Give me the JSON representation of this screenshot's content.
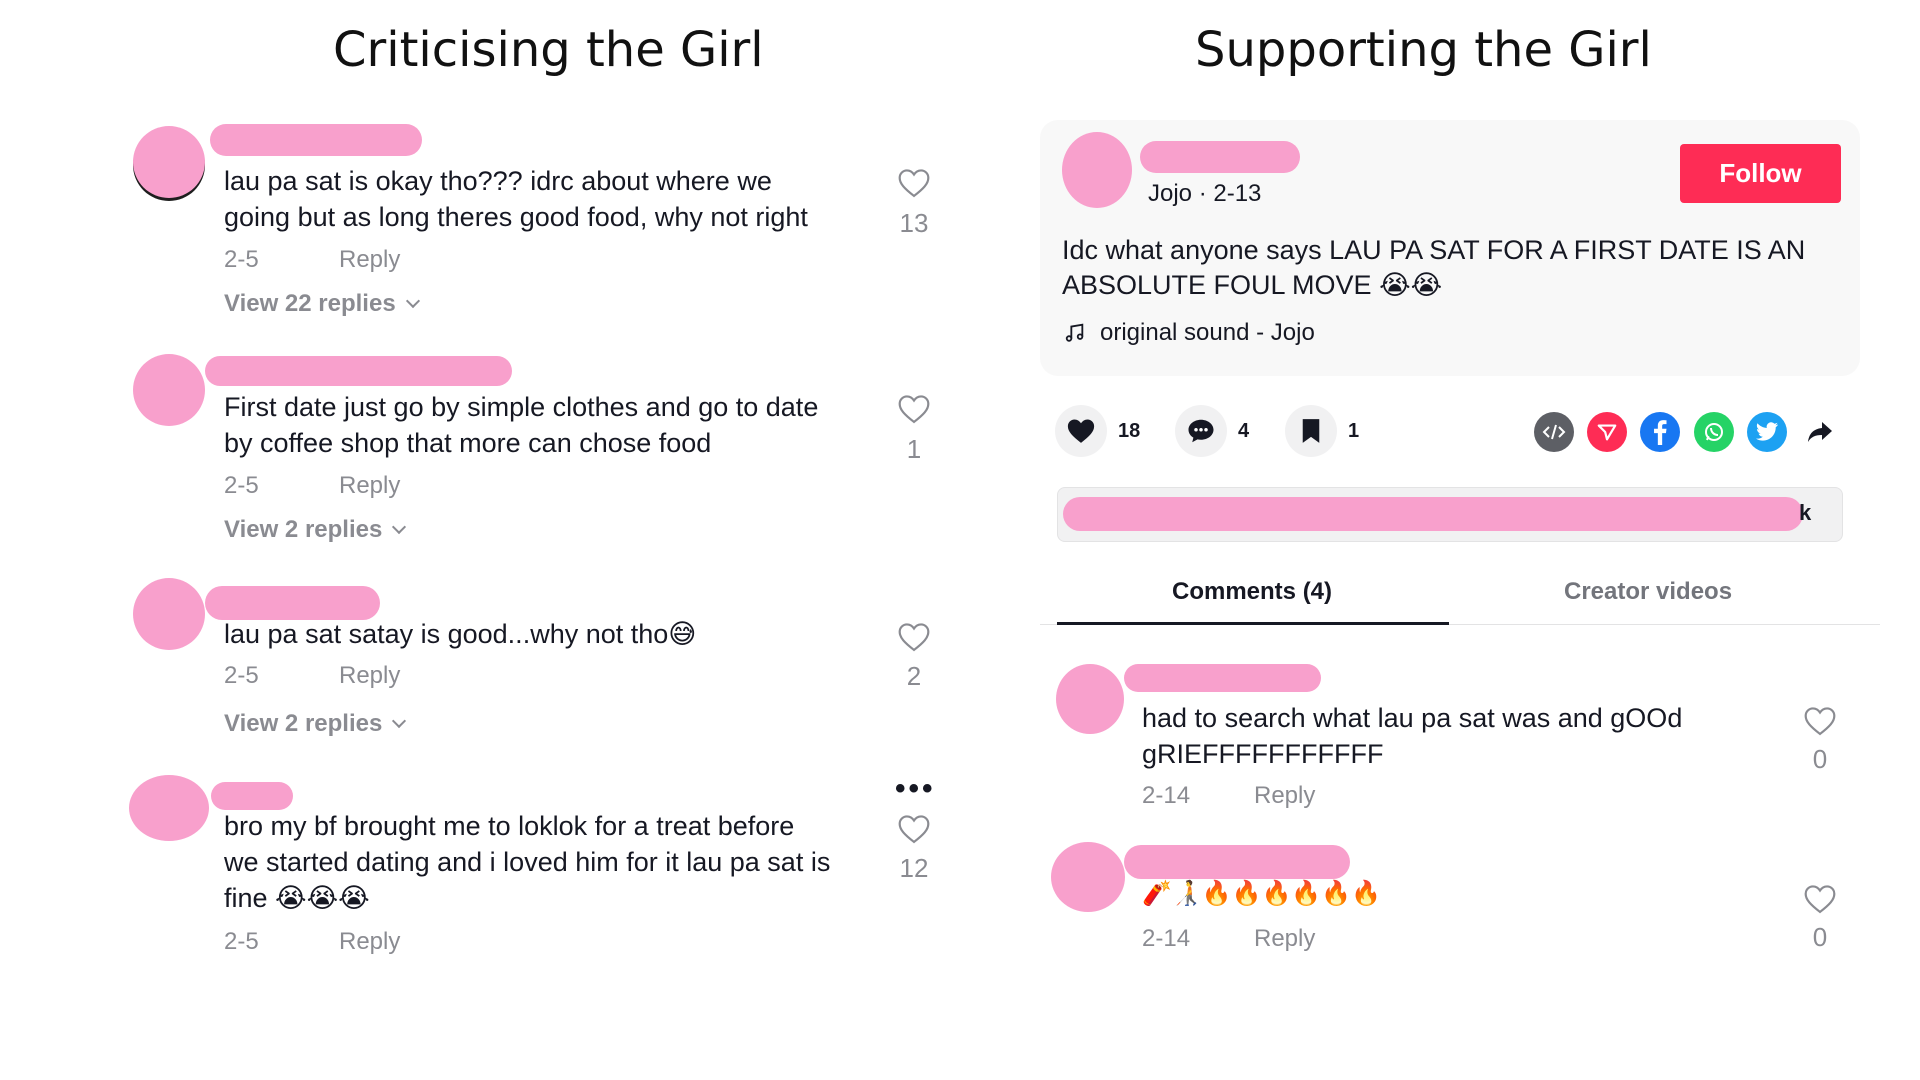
{
  "headings": {
    "left": "Criticising the Girl",
    "right": "Supporting the Girl"
  },
  "left_comments": [
    {
      "text_line1": "lau pa sat is okay tho??? idrc about where we",
      "text_line2": "going but as long theres good food, why not right",
      "date": "2-5",
      "reply": "Reply",
      "view_replies": "View 22 replies",
      "likes": "13"
    },
    {
      "text_line1": "First date just go by simple clothes and go to date",
      "text_line2": "by coffee shop that more can chose food",
      "date": "2-5",
      "reply": "Reply",
      "view_replies": "View 2 replies",
      "likes": "1"
    },
    {
      "text_line1": "lau pa sat satay is good...why not tho😅",
      "date": "2-5",
      "reply": "Reply",
      "view_replies": "View 2 replies",
      "likes": "2"
    },
    {
      "text_line1": "bro my bf brought me to loklok for a treat before",
      "text_line2": "we started dating and i loved him for it lau pa sat is",
      "text_line3": "fine 😭😭😭",
      "date": "2-5",
      "reply": "Reply",
      "likes": "12",
      "more": "•••"
    }
  ],
  "post": {
    "author_meta": "Jojo · 2-13",
    "follow_label": "Follow",
    "text_line1": "Idc what anyone says LAU PA SAT FOR A FIRST DATE IS AN",
    "text_line2": "ABSOLUTE FOUL MOVE 😭😭",
    "sound_label": "original sound - Jojo",
    "likes": "18",
    "comments": "4",
    "saves": "1",
    "link_tail": "k"
  },
  "tabs": {
    "comments": "Comments (4)",
    "creator_videos": "Creator videos"
  },
  "right_comments": [
    {
      "text_line1": "had to search what lau pa sat was and gOOd",
      "text_line2": "gRIEFFFFFFFFFFF",
      "date": "2-14",
      "reply": "Reply",
      "likes": "0"
    },
    {
      "text_line1": "🧨🧑‍🦯🔥🔥🔥🔥🔥🔥",
      "date": "2-14",
      "reply": "Reply",
      "likes": "0"
    }
  ],
  "colors": {
    "redaction_pink": "#f8a0cc",
    "follow_red": "#fe2c55",
    "secondary_text": "#8a8b91"
  },
  "icons": [
    "heart-icon",
    "comment-icon",
    "bookmark-icon",
    "embed-icon",
    "send-icon",
    "facebook-icon",
    "whatsapp-icon",
    "twitter-icon",
    "share-arrow-icon",
    "music-note-icon"
  ]
}
